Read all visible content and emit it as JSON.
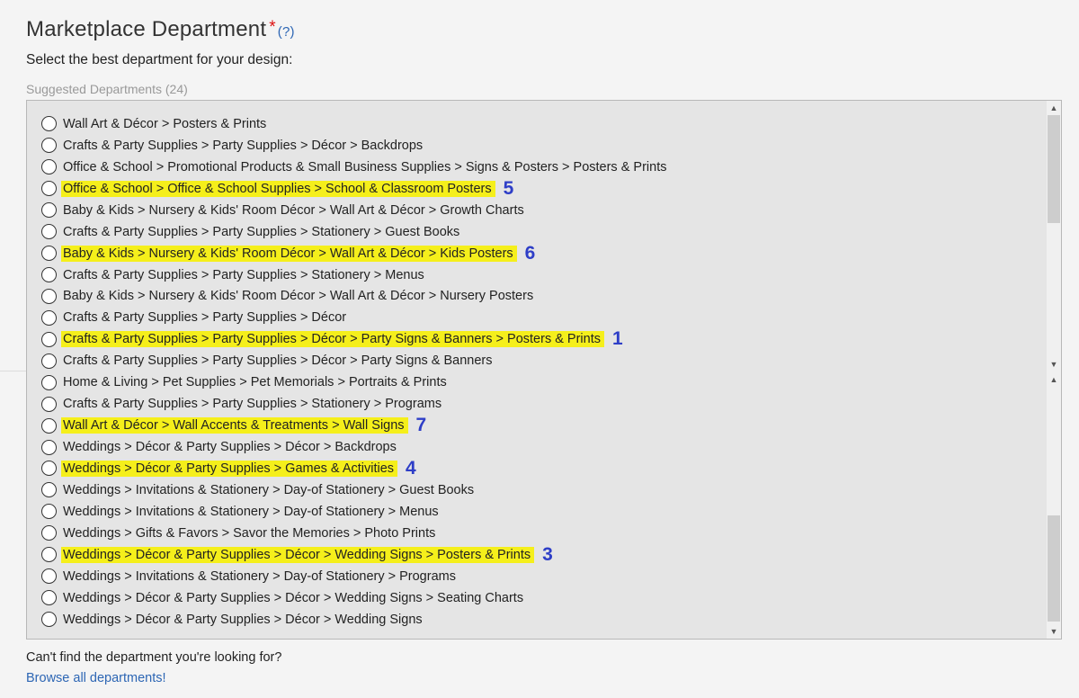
{
  "header": {
    "title": "Marketplace Department",
    "required_mark": "*",
    "help_link": "(?)",
    "subtitle": "Select the best department for your design:",
    "suggested_label": "Suggested Departments (24)"
  },
  "highlight_color": "#f5ef1b",
  "rank_color": "#2e3ec7",
  "departments": [
    {
      "path": "Wall Art & Décor > Posters & Prints",
      "highlighted": false,
      "rank": ""
    },
    {
      "path": "Crafts & Party Supplies > Party Supplies > Décor > Backdrops",
      "highlighted": false,
      "rank": ""
    },
    {
      "path": "Office & School > Promotional Products & Small Business Supplies > Signs & Posters > Posters & Prints",
      "highlighted": false,
      "rank": ""
    },
    {
      "path": "Office & School > Office & School Supplies > School & Classroom Posters",
      "highlighted": true,
      "rank": "5"
    },
    {
      "path": "Baby & Kids > Nursery & Kids' Room Décor > Wall Art & Décor > Growth Charts",
      "highlighted": false,
      "rank": ""
    },
    {
      "path": "Crafts & Party Supplies > Party Supplies > Stationery > Guest Books",
      "highlighted": false,
      "rank": ""
    },
    {
      "path": "Baby & Kids > Nursery & Kids' Room Décor > Wall Art & Décor > Kids Posters",
      "highlighted": true,
      "rank": "6"
    },
    {
      "path": "Crafts & Party Supplies > Party Supplies > Stationery > Menus",
      "highlighted": false,
      "rank": ""
    },
    {
      "path": "Baby & Kids > Nursery & Kids' Room Décor > Wall Art & Décor > Nursery Posters",
      "highlighted": false,
      "rank": ""
    },
    {
      "path": "Crafts & Party Supplies > Party Supplies > Décor",
      "highlighted": false,
      "rank": ""
    },
    {
      "path": "Crafts & Party Supplies > Party Supplies > Décor > Party Signs & Banners > Posters & Prints",
      "highlighted": true,
      "rank": "1"
    },
    {
      "path": "Crafts & Party Supplies > Party Supplies > Décor > Party Signs & Banners",
      "highlighted": false,
      "rank": ""
    },
    {
      "path": "Home & Living > Pet Supplies > Pet Memorials > Portraits & Prints",
      "highlighted": false,
      "rank": ""
    },
    {
      "path": "Crafts & Party Supplies > Party Supplies > Stationery > Programs",
      "highlighted": false,
      "rank": ""
    },
    {
      "path": "Wall Art & Décor > Wall Accents & Treatments > Wall Signs",
      "highlighted": true,
      "rank": "7"
    },
    {
      "path": "Weddings > Décor & Party Supplies > Décor > Backdrops",
      "highlighted": false,
      "rank": ""
    },
    {
      "path": "Weddings > Décor & Party Supplies > Games & Activities",
      "highlighted": true,
      "rank": "4"
    },
    {
      "path": "Weddings > Invitations & Stationery > Day-of Stationery > Guest Books",
      "highlighted": false,
      "rank": ""
    },
    {
      "path": "Weddings > Invitations & Stationery > Day-of Stationery > Menus",
      "highlighted": false,
      "rank": ""
    },
    {
      "path": "Weddings > Gifts & Favors > Savor the Memories > Photo Prints",
      "highlighted": false,
      "rank": ""
    },
    {
      "path": "Weddings > Décor & Party Supplies > Décor > Wedding Signs > Posters & Prints",
      "highlighted": true,
      "rank": "3"
    },
    {
      "path": "Weddings > Invitations & Stationery > Day-of Stationery > Programs",
      "highlighted": false,
      "rank": ""
    },
    {
      "path": "Weddings > Décor & Party Supplies > Décor > Wedding Signs > Seating Charts",
      "highlighted": false,
      "rank": ""
    },
    {
      "path": "Weddings > Décor & Party Supplies > Décor > Wedding Signs",
      "highlighted": false,
      "rank": ""
    }
  ],
  "footer": {
    "cant_find": "Can't find the department you're looking for?",
    "browse_link": "Browse all departments!"
  }
}
